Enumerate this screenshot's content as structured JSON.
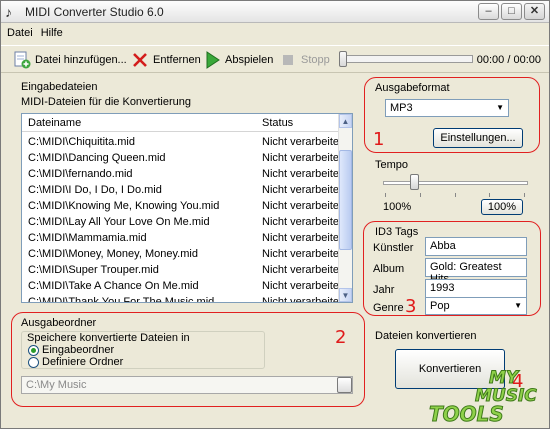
{
  "window": {
    "title": "MIDI Converter Studio 6.0"
  },
  "menu": [
    "Datei",
    "Hilfe"
  ],
  "toolbar": {
    "add_files": "Datei hinzufügen...",
    "remove": "Entfernen",
    "play": "Abspielen",
    "stop": "Stopp",
    "time": "00:00 / 00:00"
  },
  "input_files": {
    "section_title": "Eingabedateien",
    "subtitle": "MIDI-Dateien für die Konvertierung",
    "col_filename": "Dateiname",
    "col_status": "Status",
    "rows": [
      {
        "file": "C:\\MIDI\\Chiquitita.mid",
        "status": "Nicht verarbeitet"
      },
      {
        "file": "C:\\MIDI\\Dancing Queen.mid",
        "status": "Nicht verarbeitet"
      },
      {
        "file": "C:\\MIDI\\fernando.mid",
        "status": "Nicht verarbeitet"
      },
      {
        "file": "C:\\MIDI\\I Do, I Do, I Do.mid",
        "status": "Nicht verarbeitet"
      },
      {
        "file": "C:\\MIDI\\Knowing Me, Knowing You.mid",
        "status": "Nicht verarbeitet"
      },
      {
        "file": "C:\\MIDI\\Lay All Your Love On Me.mid",
        "status": "Nicht verarbeitet"
      },
      {
        "file": "C:\\MIDI\\Mammamia.mid",
        "status": "Nicht verarbeitet"
      },
      {
        "file": "C:\\MIDI\\Money, Money, Money.mid",
        "status": "Nicht verarbeitet"
      },
      {
        "file": "C:\\MIDI\\Super Trouper.mid",
        "status": "Nicht verarbeitet"
      },
      {
        "file": "C:\\MIDI\\Take A Chance On Me.mid",
        "status": "Nicht verarbeitet"
      },
      {
        "file": "C:\\MIDI\\Thank You For The Music.mid",
        "status": "Nicht verarbeitet"
      },
      {
        "file": "C:\\MIDI\\The Winner Takes All.mid",
        "status": "Nicht verarbeitet"
      }
    ]
  },
  "output_folder": {
    "section_title": "Ausgabeordner",
    "group_label": "Speichere konvertierte Dateien in",
    "option_input": "Eingabeordner",
    "option_define": "Definiere Ordner",
    "selected": "Eingabeordner",
    "path": "C:\\My Music"
  },
  "output_format": {
    "section_title": "Ausgabeformat",
    "format": "MP3",
    "settings_button": "Einstellungen..."
  },
  "tempo": {
    "section_title": "Tempo",
    "value": "100%",
    "reset_button": "100%",
    "level": 0.2
  },
  "id3": {
    "section_title": "ID3 Tags",
    "artist_label": "Künstler",
    "artist": "Abba",
    "album_label": "Album",
    "album": "Gold: Greatest Hits",
    "year_label": "Jahr",
    "year": "1993",
    "genre_label": "Genre",
    "genre": "Pop"
  },
  "convert": {
    "section_title": "Dateien konvertieren",
    "button": "Konvertieren"
  },
  "annotations": [
    "1",
    "2",
    "3",
    "4"
  ],
  "logo": {
    "line1": "MY",
    "line2": "MUSIC",
    "line3": "TOOLS"
  },
  "colors": {
    "annotation_red": "#e01a1a",
    "logo_green": "#8fd14a",
    "window_bg": "#ece9d8"
  }
}
